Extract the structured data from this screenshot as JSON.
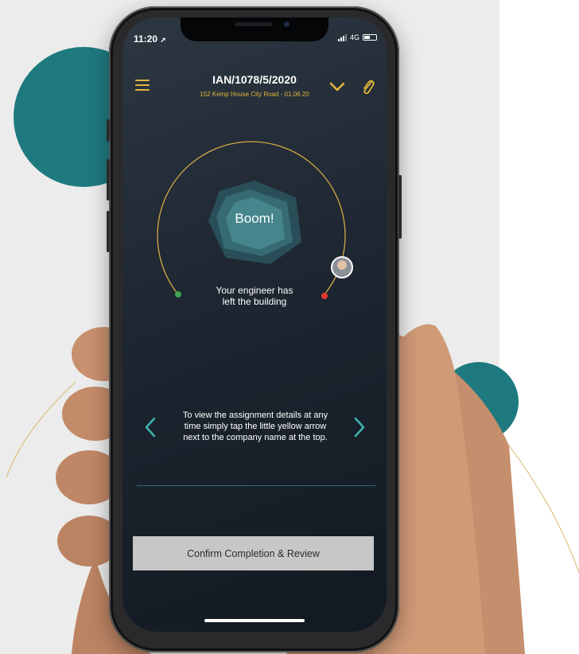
{
  "status": {
    "time": "11:20",
    "network": "4G"
  },
  "header": {
    "job_id": "IAN/1078/5/2020",
    "subtitle": "152 Kemp House City Road - 01.06.20",
    "menu_icon": "hamburger-icon",
    "dropdown_icon": "chevron-down-icon",
    "attach_icon": "paperclip-icon"
  },
  "progress": {
    "badge": "Boom!",
    "message_line1": "Your engineer has",
    "message_line2": "left the building",
    "start_color": "#3fa553",
    "end_color": "#e23a2f"
  },
  "tip": {
    "line1": "To view the assignment details at any",
    "line2": "time simply tap the little yellow arrow",
    "line3": "next to the company name at the top."
  },
  "actions": {
    "confirm_label": "Confirm Completion & Review"
  },
  "colors": {
    "accent": "#e5b53c",
    "teal": "#1e7a7f",
    "screen_bg": "#1d2631",
    "button_bg": "#c7c7c7"
  }
}
